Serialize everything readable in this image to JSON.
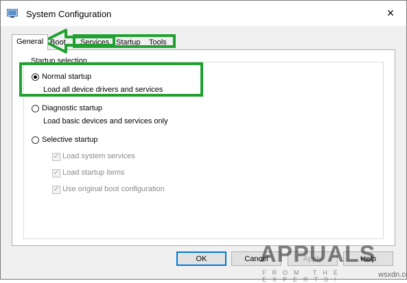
{
  "window": {
    "title": "System Configuration"
  },
  "titlebar": {
    "close_glyph": "×"
  },
  "tabs": [
    {
      "label": "General",
      "active": true
    },
    {
      "label": "Boot",
      "active": false
    },
    {
      "label": "Services",
      "active": false
    },
    {
      "label": "Startup",
      "active": false
    },
    {
      "label": "Tools",
      "active": false
    }
  ],
  "group": {
    "legend": "Startup selection"
  },
  "options": {
    "normal": {
      "label": "Normal startup",
      "desc": "Load all device drivers and services",
      "checked": true
    },
    "diagnostic": {
      "label": "Diagnostic startup",
      "desc": "Load basic devices and services only",
      "checked": false
    },
    "selective": {
      "label": "Selective startup",
      "checked": false
    }
  },
  "checkboxes": [
    {
      "label": "Load system services",
      "checked": true
    },
    {
      "label": "Load startup items",
      "checked": true
    },
    {
      "label": "Use original boot configuration",
      "checked": true
    }
  ],
  "buttons": {
    "ok": "OK",
    "cancel": "Cancel",
    "apply": "Apply",
    "help": "Help"
  },
  "watermark": {
    "brand": "APPUALS",
    "tagline": "FROM THE EXPERTS!"
  },
  "site": "wsxdn.com",
  "colors": {
    "highlight": "#1fa12f",
    "default_button_border": "#0078d7"
  }
}
